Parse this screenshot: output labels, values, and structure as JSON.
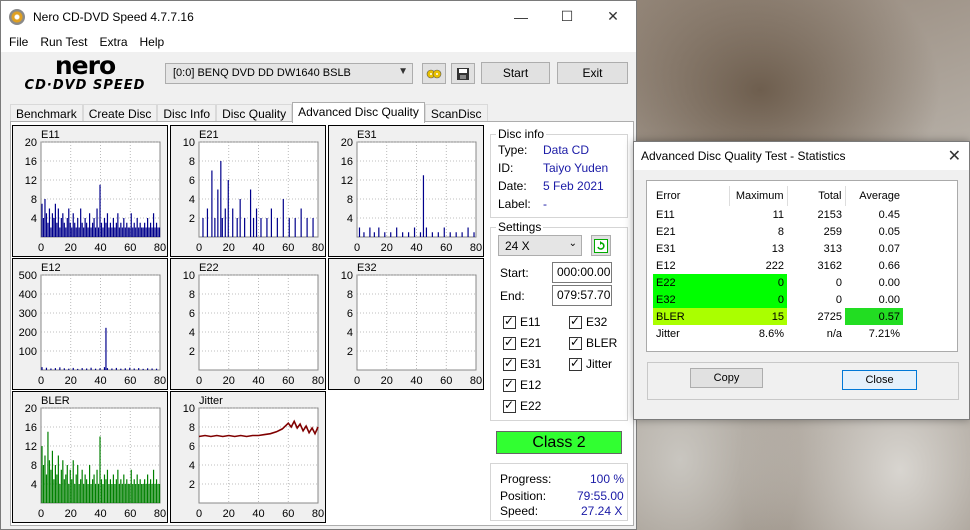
{
  "app": {
    "title": "Nero CD-DVD Speed 4.7.7.16",
    "logo_line1": "nero",
    "logo_line2": "CD·DVD SPEED"
  },
  "window_controls": {
    "minimize": "—",
    "maximize": "☐",
    "close": "✕"
  },
  "menu": [
    "File",
    "Run Test",
    "Extra",
    "Help"
  ],
  "toolbar": {
    "drive": "[0:0]   BENQ DVD DD DW1640 BSLB",
    "start_label": "Start",
    "exit_label": "Exit"
  },
  "tabs": [
    "Benchmark",
    "Create Disc",
    "Disc Info",
    "Disc Quality",
    "Advanced Disc Quality",
    "ScanDisc"
  ],
  "active_tab": "Advanced Disc Quality",
  "disc_info": {
    "title": "Disc info",
    "type_label": "Type:",
    "type": "Data CD",
    "id_label": "ID:",
    "id": "Taiyo Yuden",
    "date_label": "Date:",
    "date": "5 Feb 2021",
    "label_label": "Label:",
    "label": "-"
  },
  "settings": {
    "title": "Settings",
    "speed": "24 X",
    "start_label": "Start:",
    "start": "000:00.00",
    "end_label": "End:",
    "end": "079:57.70",
    "checkboxes": [
      {
        "label": "E11",
        "checked": true
      },
      {
        "label": "E32",
        "checked": true
      },
      {
        "label": "E21",
        "checked": true
      },
      {
        "label": "BLER",
        "checked": true
      },
      {
        "label": "E31",
        "checked": true
      },
      {
        "label": "Jitter",
        "checked": true
      },
      {
        "label": "E12",
        "checked": true
      },
      {
        "label": "E22",
        "checked": true
      }
    ]
  },
  "class_label": "Class 2",
  "progress": {
    "progress_label": "Progress:",
    "progress": "100 %",
    "position_label": "Position:",
    "position": "79:55.00",
    "speed_label": "Speed:",
    "speed": "27.24 X"
  },
  "stats": {
    "title": "Advanced Disc Quality Test - Statistics",
    "headers": [
      "Error",
      "Maximum",
      "Total",
      "Average"
    ],
    "rows": [
      {
        "error": "E11",
        "max": "11",
        "total": "2153",
        "avg": "0.45"
      },
      {
        "error": "E21",
        "max": "8",
        "total": "259",
        "avg": "0.05"
      },
      {
        "error": "E31",
        "max": "13",
        "total": "313",
        "avg": "0.07"
      },
      {
        "error": "E12",
        "max": "222",
        "total": "3162",
        "avg": "0.66"
      },
      {
        "error": "E22",
        "max": "0",
        "total": "0",
        "avg": "0.00"
      },
      {
        "error": "E32",
        "max": "0",
        "total": "0",
        "avg": "0.00"
      },
      {
        "error": "BLER",
        "max": "15",
        "total": "2725",
        "avg": "0.57"
      },
      {
        "error": "Jitter",
        "max": "8.6%",
        "total": "n/a",
        "avg": "7.21%"
      }
    ],
    "copy_label": "Copy",
    "close_label": "Close",
    "colors": {
      "green": "#00ff00",
      "yellow_green": "#aaff00",
      "avg_green": "#22dd22"
    }
  },
  "chart_data": [
    {
      "type": "bar",
      "title": "E11",
      "ylim": [
        0,
        20
      ],
      "yticks": [
        "20",
        "16",
        "12",
        "8",
        "4"
      ],
      "xticks": [
        "0",
        "20",
        "40",
        "60",
        "80"
      ],
      "color": "#00008b",
      "x": [
        0,
        1,
        2,
        3,
        4,
        5,
        6,
        7,
        8,
        9,
        10,
        11,
        12,
        13,
        14,
        15,
        16,
        17,
        18,
        19,
        20,
        21,
        22,
        23,
        24,
        25,
        26,
        27,
        28,
        29,
        30,
        31,
        32,
        33,
        34,
        35,
        36,
        37,
        38,
        39,
        40,
        41,
        42,
        43,
        44,
        45,
        46,
        47,
        48,
        49,
        50,
        51,
        52,
        53,
        54,
        55,
        56,
        57,
        58,
        59,
        60,
        61,
        62,
        63,
        64,
        65,
        66,
        67,
        68,
        69,
        70,
        71,
        72,
        73,
        74,
        75,
        76,
        77,
        78,
        79
      ],
      "values": [
        7,
        4,
        8,
        5,
        3,
        6,
        2,
        5,
        4,
        7,
        3,
        6,
        2,
        4,
        5,
        3,
        2,
        4,
        6,
        3,
        2,
        5,
        3,
        2,
        4,
        2,
        6,
        3,
        2,
        4,
        3,
        2,
        5,
        2,
        3,
        4,
        2,
        6,
        2,
        11,
        3,
        2,
        4,
        3,
        5,
        2,
        3,
        2,
        4,
        2,
        3,
        5,
        2,
        3,
        2,
        4,
        2,
        3,
        2,
        2,
        5,
        2,
        3,
        2,
        4,
        2,
        3,
        2,
        2,
        3,
        2,
        4,
        2,
        3,
        2,
        5,
        2,
        3,
        2,
        2
      ]
    },
    {
      "type": "bar",
      "title": "E21",
      "ylim": [
        0,
        10
      ],
      "yticks": [
        "10",
        "8",
        "6",
        "4",
        "2"
      ],
      "xticks": [
        "0",
        "20",
        "40",
        "60",
        "80"
      ],
      "color": "#00008b",
      "x": [
        2,
        5,
        8,
        10,
        12,
        14,
        15,
        17,
        19,
        22,
        25,
        27,
        30,
        34,
        36,
        38,
        41,
        45,
        48,
        52,
        56,
        60,
        64,
        68,
        72,
        76
      ],
      "values": [
        2,
        3,
        7,
        2,
        5,
        8,
        2,
        3,
        6,
        3,
        2,
        4,
        2,
        5,
        2,
        3,
        2,
        2,
        3,
        2,
        4,
        2,
        2,
        3,
        2,
        2
      ]
    },
    {
      "type": "bar",
      "title": "E31",
      "ylim": [
        0,
        20
      ],
      "yticks": [
        "20",
        "16",
        "12",
        "8",
        "4"
      ],
      "xticks": [
        "0",
        "20",
        "40",
        "60",
        "80"
      ],
      "color": "#00008b",
      "x": [
        1,
        4,
        8,
        11,
        14,
        18,
        22,
        26,
        30,
        34,
        38,
        42,
        44,
        46,
        50,
        54,
        58,
        62,
        66,
        70,
        74,
        78
      ],
      "values": [
        2,
        1,
        2,
        1,
        2,
        1,
        1,
        2,
        1,
        1,
        2,
        1,
        13,
        2,
        1,
        1,
        2,
        1,
        1,
        1,
        2,
        1
      ]
    },
    {
      "type": "bar",
      "title": "E12",
      "ylim": [
        0,
        500
      ],
      "yticks": [
        "500",
        "400",
        "300",
        "200",
        "100"
      ],
      "xticks": [
        "0",
        "20",
        "40",
        "60",
        "80"
      ],
      "color": "#00008b",
      "x": [
        0,
        3,
        6,
        9,
        12,
        15,
        18,
        21,
        24,
        27,
        30,
        33,
        36,
        39,
        42,
        43,
        44,
        47,
        50,
        53,
        56,
        59,
        62,
        65,
        68,
        71,
        74,
        77
      ],
      "values": [
        15,
        12,
        8,
        10,
        14,
        9,
        7,
        11,
        6,
        10,
        8,
        12,
        7,
        9,
        15,
        222,
        10,
        8,
        11,
        7,
        9,
        12,
        8,
        10,
        6,
        9,
        8,
        7
      ]
    },
    {
      "type": "bar",
      "title": "E22",
      "ylim": [
        0,
        10
      ],
      "yticks": [
        "10",
        "8",
        "6",
        "4",
        "2"
      ],
      "xticks": [
        "0",
        "20",
        "40",
        "60",
        "80"
      ],
      "color": "#00008b",
      "x": [],
      "values": []
    },
    {
      "type": "bar",
      "title": "E32",
      "ylim": [
        0,
        10
      ],
      "yticks": [
        "10",
        "8",
        "6",
        "4",
        "2"
      ],
      "xticks": [
        "0",
        "20",
        "40",
        "60",
        "80"
      ],
      "color": "#00008b",
      "x": [],
      "values": []
    },
    {
      "type": "bar",
      "title": "BLER",
      "ylim": [
        0,
        20
      ],
      "yticks": [
        "20",
        "16",
        "12",
        "8",
        "4"
      ],
      "xticks": [
        "0",
        "20",
        "40",
        "60",
        "80"
      ],
      "color": "#008000",
      "x": [
        0,
        1,
        2,
        3,
        4,
        5,
        6,
        7,
        8,
        9,
        10,
        11,
        12,
        13,
        14,
        15,
        16,
        17,
        18,
        19,
        20,
        21,
        22,
        23,
        24,
        25,
        26,
        27,
        28,
        29,
        30,
        31,
        32,
        33,
        34,
        35,
        36,
        37,
        38,
        39,
        40,
        41,
        42,
        43,
        44,
        45,
        46,
        47,
        48,
        49,
        50,
        51,
        52,
        53,
        54,
        55,
        56,
        57,
        58,
        59,
        60,
        61,
        62,
        63,
        64,
        65,
        66,
        67,
        68,
        69,
        70,
        71,
        72,
        73,
        74,
        75,
        76,
        77,
        78,
        79
      ],
      "values": [
        12,
        8,
        10,
        6,
        15,
        9,
        7,
        11,
        5,
        8,
        6,
        10,
        4,
        7,
        9,
        5,
        6,
        8,
        4,
        7,
        5,
        9,
        4,
        6,
        8,
        4,
        5,
        7,
        4,
        6,
        5,
        4,
        8,
        4,
        5,
        6,
        4,
        7,
        4,
        14,
        5,
        4,
        6,
        5,
        7,
        4,
        5,
        4,
        6,
        4,
        5,
        7,
        4,
        5,
        4,
        6,
        4,
        5,
        4,
        4,
        7,
        4,
        5,
        4,
        6,
        4,
        5,
        4,
        4,
        5,
        4,
        6,
        4,
        5,
        4,
        7,
        4,
        5,
        4,
        4
      ]
    },
    {
      "type": "line",
      "title": "Jitter",
      "ylim": [
        0,
        10
      ],
      "yticks": [
        "10",
        "8",
        "6",
        "4",
        "2"
      ],
      "xticks": [
        "0",
        "20",
        "40",
        "60",
        "80"
      ],
      "color": "#800000",
      "x": [
        0,
        4,
        8,
        12,
        16,
        20,
        24,
        28,
        32,
        36,
        40,
        44,
        48,
        52,
        56,
        60,
        62,
        64,
        66,
        68,
        70,
        72,
        74,
        76,
        78,
        80
      ],
      "values": [
        7.0,
        7.1,
        7.0,
        7.1,
        7.0,
        7.1,
        7.0,
        7.1,
        7.0,
        7.1,
        7.1,
        7.2,
        7.3,
        7.5,
        7.8,
        8.4,
        8.0,
        8.6,
        7.9,
        8.3,
        7.6,
        8.1,
        7.4,
        7.9,
        7.3,
        8.0
      ]
    }
  ]
}
